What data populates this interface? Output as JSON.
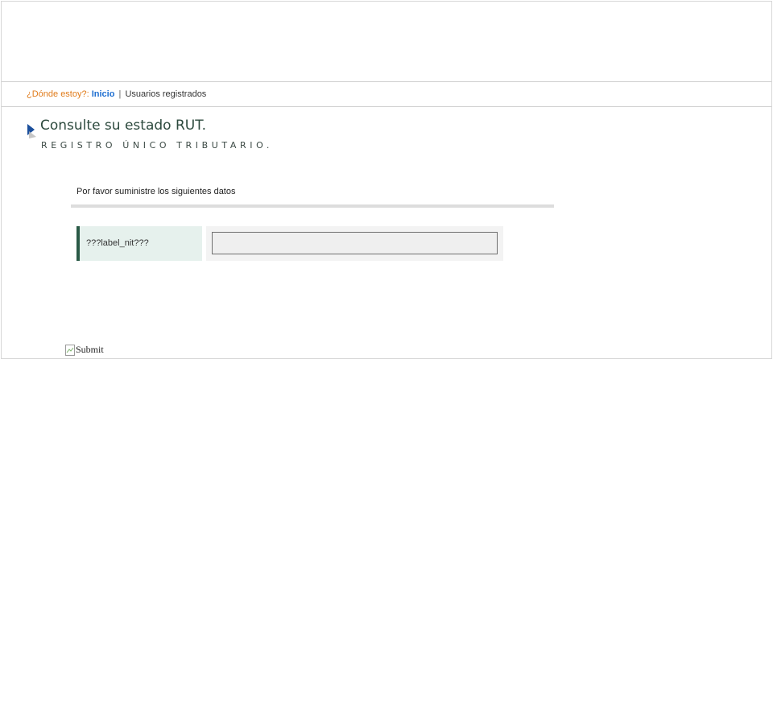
{
  "breadcrumb": {
    "label": "¿Dónde estoy?:",
    "home_link": "Inicio",
    "separator": "|",
    "current": "Usuarios registrados"
  },
  "heading": {
    "title": "Consulte su estado RUT.",
    "subtitle": "REGISTRO ÚNICO TRIBUTARIO."
  },
  "form": {
    "instructions": "Por favor suministre los siguientes datos",
    "nit_label": "???label_nit???",
    "nit_value": "",
    "submit_alt": "Submit"
  },
  "colors": {
    "breadcrumb_label": "#e07b1a",
    "breadcrumb_link": "#1f6fd1",
    "title": "#2d4a3e",
    "label_bg": "#e6f1ed",
    "label_accent": "#2a5a46"
  },
  "icons": {
    "title_marker": "chevron-right-icon",
    "submit_placeholder": "broken-image-icon"
  }
}
